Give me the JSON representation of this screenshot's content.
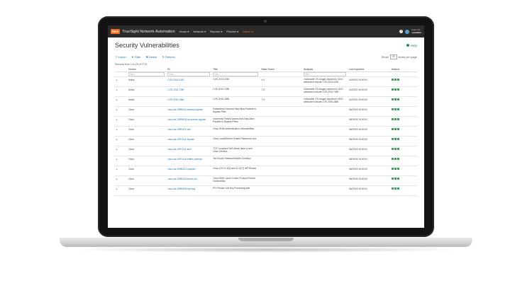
{
  "app": {
    "logo": "bmc",
    "name": "TrueSight Network Automation",
    "nav": [
      "Home ▾",
      "Network ▾",
      "Reports ▾",
      "Policies ▾",
      "Admin ▾"
    ],
    "user_line1": "User Info",
    "user_line2": "sysadmin"
  },
  "page": {
    "title": "Security Vulnerabilities",
    "help": "Help",
    "toolbar": {
      "import": "Import",
      "filter": "Filter",
      "delete": "Delete",
      "refresh": "Refresh"
    },
    "show_label": "Show",
    "page_size": "25",
    "items_per_page": "items per page",
    "records_text": "Records from 1 to 25 of 2713"
  },
  "table": {
    "headers": [
      "",
      "Vendor",
      "ID",
      "Title",
      "Base Score",
      "Analysis",
      "Last Imported",
      "Actions"
    ],
    "filters": [
      "",
      "Filter",
      "Filter",
      "Filter",
      "",
      "Filter",
      "",
      ""
    ],
    "rows": [
      {
        "vendor": "Arista",
        "id": "CVE-2013-2230",
        "title": "CVE-2013-2230",
        "score": "4.9",
        "analysis": "Vulnerable OS images reported in NVD advisories include CVE-2013-2230",
        "imported": "01/08/19 15:00:00"
      },
      {
        "vendor": "Arista",
        "id": "CVE-2014-7289",
        "title": "CVE-2014-7289",
        "score": "7.5",
        "analysis": "Vulnerable OS images reported in NVD advisories include CVE-2014-7289",
        "imported": "01/23/19 15:00:00"
      },
      {
        "vendor": "Arista",
        "id": "CVE-2015-1866",
        "title": "CVE-2015-1866",
        "score": "7.5",
        "analysis": "Vulnerable OS images reported in NVD advisories include CVE-2015-1866",
        "imported": "01/23/19 15:00:00"
      },
      {
        "vendor": "Cisco",
        "id": "cisco-sa-19990401-tacplus-bypass",
        "title": "Established Keyword May Allow Packets to Bypass Filter",
        "score": "",
        "analysis": "",
        "imported": "08/19/18 15:00:00"
      },
      {
        "vendor": "Cisco",
        "id": "cisco-sa-19990524-acl-packet-bypass",
        "title": "Incorrectly Parsed Access lists May Allow Packets to Bypass Filters",
        "score": "",
        "analysis": "",
        "imported": "08/19/18 15:00:00"
      },
      {
        "vendor": "Cisco",
        "id": "cisco-sa-19991110-ssh",
        "title": "Cisco SHell Authentication Vulnerabilities",
        "score": "",
        "analysis": "",
        "imported": "08/19/18 15:00:00"
      },
      {
        "vendor": "Cisco",
        "id": "cisco-sa-19971111-bypass",
        "title": "Cisco LocalDirector Enable Password Loss",
        "score": "",
        "analysis": "",
        "imported": "08/19/18 15:00:00"
      },
      {
        "vendor": "Cisco",
        "id": "cisco-sa-19971111-land",
        "title": "TCP Loopback DoS Attack (land.c) and Cisco Devices",
        "score": "",
        "analysis": "",
        "imported": "08/19/18 15:00:00"
      },
      {
        "vendor": "Cisco",
        "id": "cisco-sa-19971116-buffer-overflow",
        "title": "Tac Router Password Buffer Overflow",
        "score": "",
        "analysis": "",
        "imported": "08/19/18 15:00:00"
      },
      {
        "vendor": "Cisco",
        "id": "cisco-sa-19980222-caopain",
        "title": "Cisco IOS 11.2(4) and 11.2(17) WP Reload",
        "score": "",
        "analysis": "",
        "imported": "08/19/18 15:00:00"
      },
      {
        "vendor": "Cisco",
        "id": "cisco-sa-19980420-ecure-pix",
        "title": "Cisco Web Cache Control Protocol Router Vulnerability",
        "score": "",
        "analysis": "",
        "imported": "08/19/18 15:00:00"
      },
      {
        "vendor": "Cisco",
        "id": "cisco-sa-19980626-nat-bug",
        "title": "PIX Private Link Key Processing and",
        "score": "",
        "analysis": "",
        "imported": "08/19/18 15:00:00"
      }
    ]
  }
}
